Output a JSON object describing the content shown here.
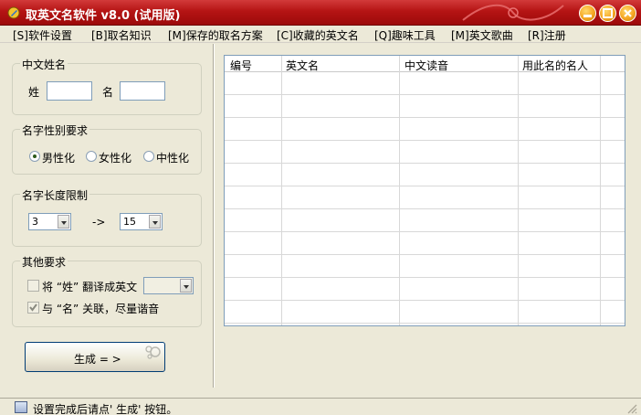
{
  "window": {
    "title": "取英文名软件 v8.0 (试用版)"
  },
  "menu": [
    {
      "label": "[S]软件设置"
    },
    {
      "label": "[B]取名知识"
    },
    {
      "label": "[M]保存的取名方案"
    },
    {
      "label": "[C]收藏的英文名"
    },
    {
      "label": "[Q]趣味工具"
    },
    {
      "label": "[M]英文歌曲"
    },
    {
      "label": "[R]注册"
    }
  ],
  "chinese_name": {
    "title": "中文姓名",
    "surname_label": "姓",
    "surname_value": "",
    "given_label": "名",
    "given_value": ""
  },
  "gender": {
    "title": "名字性别要求",
    "options": [
      {
        "label": "男性化",
        "selected": true
      },
      {
        "label": "女性化",
        "selected": false
      },
      {
        "label": "中性化",
        "selected": false
      }
    ]
  },
  "length": {
    "title": "名字长度限制",
    "min": "3",
    "arrow": "->",
    "max": "15"
  },
  "other": {
    "title": "其他要求",
    "translate_surname": {
      "label": "将 “姓” 翻译成英文",
      "checked": false,
      "disabled": true
    },
    "translate_combo_value": "",
    "associate_given": {
      "label": "与 “名” 关联，尽量谐音",
      "checked": true,
      "disabled": true
    }
  },
  "generate_button": {
    "label": "生成 = >"
  },
  "table": {
    "columns": [
      "编号",
      "英文名",
      "中文读音",
      "用此名的名人"
    ],
    "rows": []
  },
  "status": {
    "text": "设置完成后请点' 生成' 按钮。"
  },
  "colors": {
    "titlebar": "#b51414",
    "accent": "#2d5a1c",
    "face": "#ece9d8"
  },
  "icons": {
    "app": "pen-icon",
    "minimize": "minimize-icon",
    "maximize": "maximize-icon",
    "close": "close-icon",
    "status": "window-icon"
  }
}
